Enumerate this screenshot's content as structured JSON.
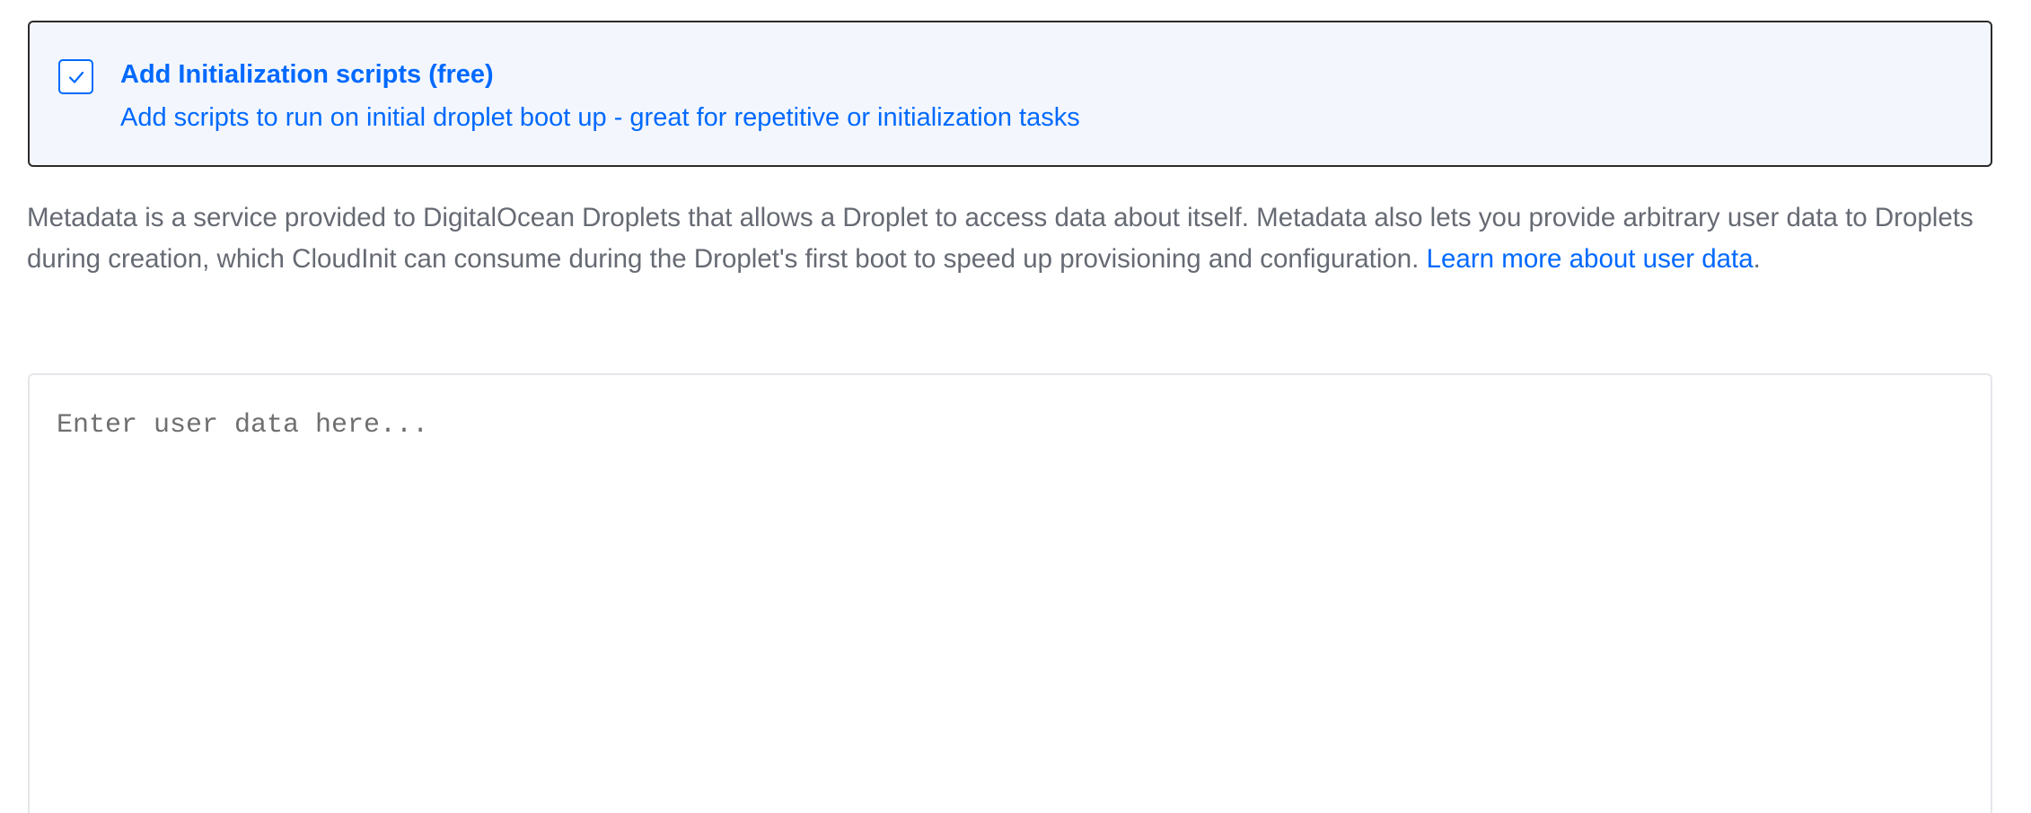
{
  "init_scripts": {
    "checked": true,
    "title": "Add Initialization scripts (free)",
    "subtitle": "Add scripts to run on initial droplet boot up - great for repetitive or initialization tasks",
    "checkbox_icon": "checkmark-icon",
    "accent_color": "#0069ff"
  },
  "metadata_info": {
    "text": "Metadata is a service provided to DigitalOcean Droplets that allows a Droplet to access data about itself. Metadata also lets you provide arbitrary user data to Droplets during creation, which CloudInit can consume during the Droplet's first boot to speed up provisioning and configuration.",
    "link_label": "Learn more about user data",
    "trailing": "."
  },
  "user_data": {
    "placeholder": "Enter user data here...",
    "value": ""
  }
}
